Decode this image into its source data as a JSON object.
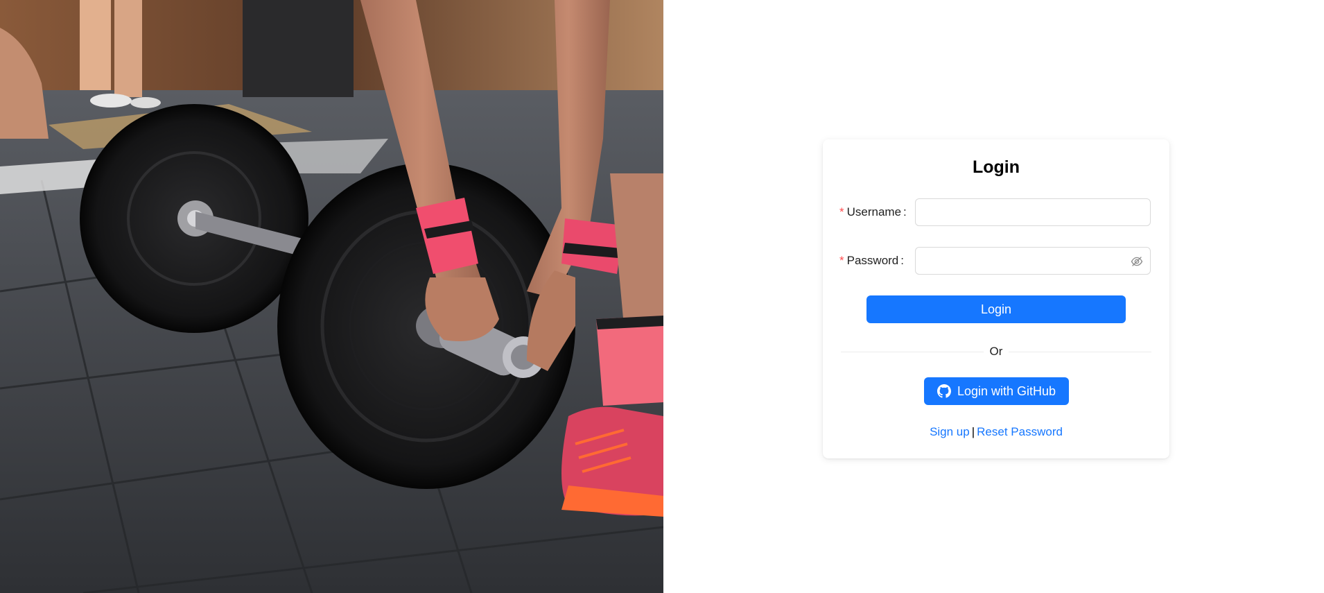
{
  "hero": {
    "image": "gym-deadlift-photo"
  },
  "login_card": {
    "title": "Login",
    "username": {
      "label": "Username",
      "colon": ":",
      "required_mark": "*",
      "value": ""
    },
    "password": {
      "label": "Password",
      "colon": ":",
      "required_mark": "*",
      "value": "",
      "visibility_icon": "eye-invisible-icon"
    },
    "login_button": "Login",
    "divider_text": "Or",
    "github_button": {
      "label": "Login with GitHub",
      "icon": "github-icon"
    },
    "links": {
      "signup": "Sign up",
      "separator": "|",
      "reset_password": "Reset Password"
    }
  },
  "colors": {
    "primary": "#1677ff",
    "required": "#ff4d4f",
    "input_border": "#d9d9d9"
  }
}
